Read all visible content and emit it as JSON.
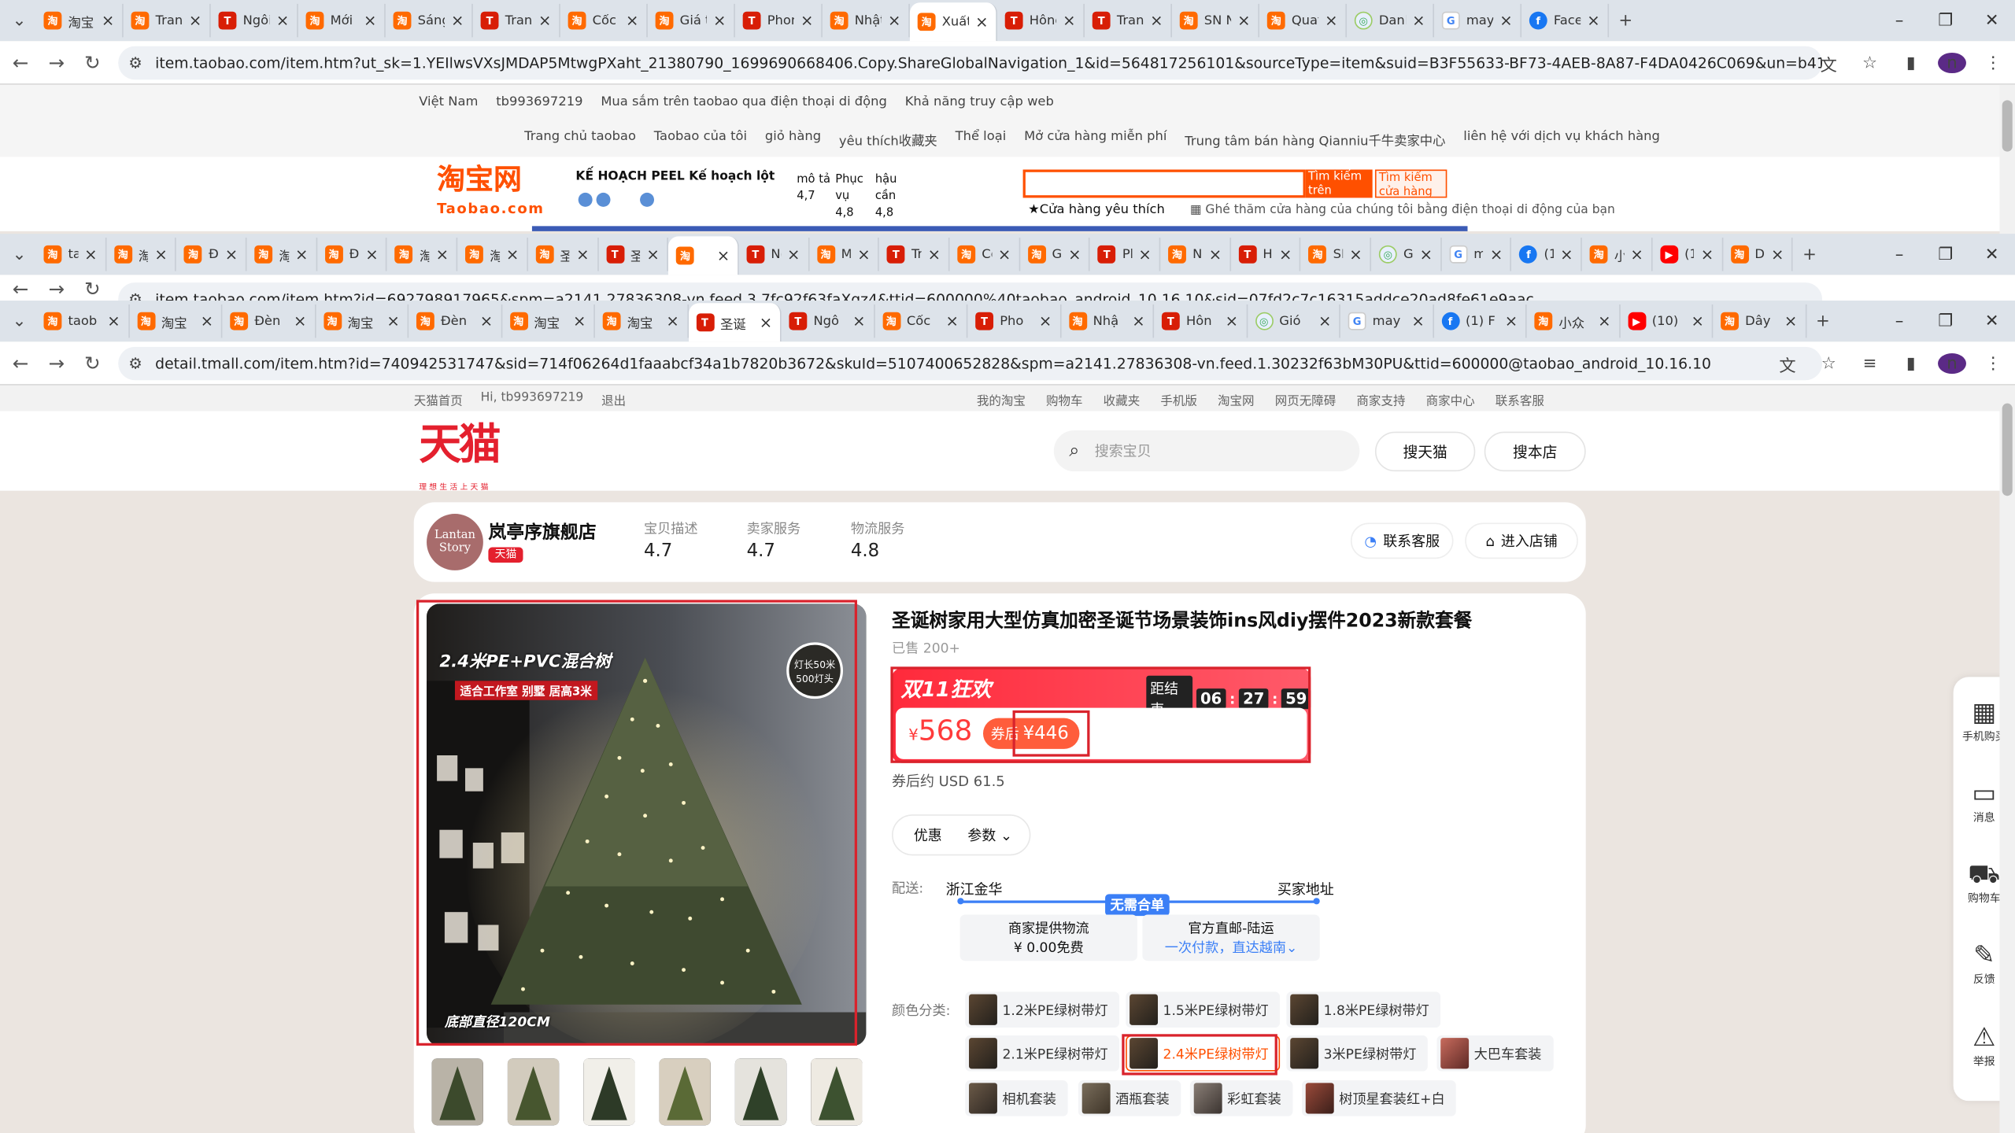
{
  "window1": {
    "tabs": [
      {
        "label": "淘宝",
        "icon": "taobao"
      },
      {
        "label": "Trang",
        "icon": "taobao"
      },
      {
        "label": "Ngôi",
        "icon": "tmall"
      },
      {
        "label": "Mới",
        "icon": "taobao"
      },
      {
        "label": "Sáng",
        "icon": "taobao"
      },
      {
        "label": "Tranh",
        "icon": "tmall"
      },
      {
        "label": "Cốc c",
        "icon": "taobao"
      },
      {
        "label": "Giá t",
        "icon": "taobao"
      },
      {
        "label": "Phon",
        "icon": "tmall"
      },
      {
        "label": "Nhật",
        "icon": "taobao"
      },
      {
        "label": "Xuất",
        "icon": "taobao",
        "active": true
      },
      {
        "label": "Hông",
        "icon": "tmall"
      },
      {
        "label": "Trang",
        "icon": "tmall"
      },
      {
        "label": "SN N",
        "icon": "taobao"
      },
      {
        "label": "Quat",
        "icon": "taobao"
      },
      {
        "label": "Danh",
        "icon": "globe"
      },
      {
        "label": "may",
        "icon": "g"
      },
      {
        "label": "Facel",
        "icon": "fb"
      }
    ],
    "url": "item.taobao.com/item.htm?ut_sk=1.YEIlwsVXsJMDAP5MtwgPXaht_21380790_1699690668406.Copy.ShareGlobalNavigation_1&id=564817256101&sourceType=item&suid=B3F55633-BF73-4AEB-8A87-F4DA0426C069&un=b41e035e55e69c9ff90c85b561b0b179&share_crt_v=..."
  },
  "taobao_page": {
    "top_row1": [
      "Việt Nam",
      "tb993697219",
      "Mua sắm trên taobao qua điện thoại di động",
      "Khả năng truy cập web"
    ],
    "top_row2": [
      "Trang chủ taobao",
      "Taobao của tôi",
      "giỏ hàng",
      "yêu thích收藏夹",
      "Thể loại",
      "Mở cửa hàng miễn phí",
      "Trung tâm bán hàng Qianniu千牛卖家中心",
      "liên hệ với dịch vụ khách hàng"
    ],
    "logo_main": "淘宝网",
    "logo_sub": "Taobao.com",
    "peel": "KẾ HOẠCH PEEL Kế hoạch lột",
    "ratings": {
      "c1": "mô tả",
      "c1v": "4,7",
      "c2": "Phục vụ",
      "c2v": "4,8",
      "c3": "hậu cần",
      "c3v": "4,8"
    },
    "search_btn1": "Tìm kiếm trên taobao",
    "search_btn2": "Tìm kiếm cửa hàng này",
    "fav_store": "Cửa hàng yêu thích",
    "visit_store": "Ghé thăm cửa hàng của chúng tôi bằng điện thoại di động của bạn"
  },
  "window2": {
    "tabs": [
      {
        "label": "taob",
        "icon": "taobao"
      },
      {
        "label": "淘宝",
        "icon": "taobao"
      },
      {
        "label": "Đèn",
        "icon": "taobao"
      },
      {
        "label": "淘宝",
        "icon": "taobao"
      },
      {
        "label": "Đèn",
        "icon": "taobao"
      },
      {
        "label": "淘宝",
        "icon": "taobao"
      },
      {
        "label": "淘宝",
        "icon": "taobao"
      },
      {
        "label": "圣诞",
        "icon": "taobao"
      },
      {
        "label": "圣诞",
        "icon": "tmall"
      },
      {
        "label": "",
        "icon": "taobao",
        "active": true
      },
      {
        "label": "Ngô",
        "icon": "tmall"
      },
      {
        "label": "Mới",
        "icon": "taobao"
      },
      {
        "label": "Tran",
        "icon": "tmall"
      },
      {
        "label": "Cốc",
        "icon": "taobao"
      },
      {
        "label": "Giá",
        "icon": "taobao"
      },
      {
        "label": "Phor",
        "icon": "tmall"
      },
      {
        "label": "Nhậ",
        "icon": "taobao"
      },
      {
        "label": "Hôn",
        "icon": "tmall"
      },
      {
        "label": "SN",
        "icon": "taobao"
      },
      {
        "label": "Gió",
        "icon": "globe"
      },
      {
        "label": "may",
        "icon": "g"
      },
      {
        "label": "(1) F",
        "icon": "fb"
      },
      {
        "label": "小众",
        "icon": "taobao"
      },
      {
        "label": "(10)",
        "icon": "yt"
      },
      {
        "label": "Dây",
        "icon": "taobao"
      }
    ],
    "url": "item.taobao.com/item.htm?id=692798917965&spm=a2141.27836308-vn.feed.3.7fc92f63faXqz4&ttid=600000%40taobao_android_10.16.10&sid=07fd2c7c16315addce20ad8fe61e9aac"
  },
  "window3": {
    "tabs": [
      {
        "label": "taob",
        "icon": "taobao"
      },
      {
        "label": "淘宝",
        "icon": "taobao"
      },
      {
        "label": "Đèn",
        "icon": "taobao"
      },
      {
        "label": "淘宝",
        "icon": "taobao"
      },
      {
        "label": "Đèn",
        "icon": "taobao"
      },
      {
        "label": "淘宝",
        "icon": "taobao"
      },
      {
        "label": "淘宝",
        "icon": "taobao"
      },
      {
        "label": "圣诞",
        "icon": "tmall",
        "active": true
      },
      {
        "label": "Ngô",
        "icon": "tmall"
      },
      {
        "label": "Cốc",
        "icon": "taobao"
      },
      {
        "label": "Pho",
        "icon": "tmall"
      },
      {
        "label": "Nhậ",
        "icon": "taobao"
      },
      {
        "label": "Hôn",
        "icon": "tmall"
      },
      {
        "label": "Gió",
        "icon": "globe"
      },
      {
        "label": "may",
        "icon": "g"
      },
      {
        "label": "(1) F",
        "icon": "fb"
      },
      {
        "label": "小众",
        "icon": "taobao"
      },
      {
        "label": "(10)",
        "icon": "yt"
      },
      {
        "label": "Dây",
        "icon": "taobao"
      }
    ],
    "url": "detail.tmall.com/item.htm?id=740942531747&sid=714f06264d1faaabcf34a1b7820b3672&skuId=5107400652828&spm=a2141.27836308-vn.feed.1.30232f63bM30PU&ttid=600000@taobao_android_10.16.10"
  },
  "tmall": {
    "top_left": [
      "天猫首页",
      "Hi, tb993697219",
      "退出"
    ],
    "top_right": [
      "我的淘宝",
      "购物车",
      "收藏夹",
      "手机版",
      "淘宝网",
      "网页无障碍",
      "商家支持",
      "商家中心",
      "联系客服"
    ],
    "logo": "天猫",
    "logo_sub": "理想生活上天猫",
    "search_placeholder": "搜索宝贝",
    "btn_search_tmall": "搜天猫",
    "btn_search_shop": "搜本店",
    "shop": {
      "logo_text": "Lantan Story",
      "name": "岚亭序旗舰店",
      "badge": "天猫",
      "scores": [
        {
          "label": "宝贝描述",
          "value": "4.7"
        },
        {
          "label": "卖家服务",
          "value": "4.7"
        },
        {
          "label": "物流服务",
          "value": "4.8"
        }
      ],
      "btn_service": "联系客服",
      "btn_enter": "进入店铺"
    },
    "product": {
      "img_text1": "2.4米PE+PVC混合树",
      "img_text2": "适合工作室 别墅 居高3米",
      "img_text3": "底部直径120CM",
      "img_badge": "灯长50米 500灯头",
      "title": "圣诞树家用大型仿真加密圣诞节场景装饰ins风diy摆件2023新款套餐",
      "sold": "已售 200+",
      "promo_title": "双11狂欢",
      "countdown_label": "距结束",
      "countdown": [
        "06",
        "27",
        "59"
      ],
      "price_symbol": "¥",
      "price": "568",
      "coupon_label": "券后",
      "coupon_price": "¥446",
      "usd": "券后约 USD 61.5",
      "tab_discount": "优惠",
      "tab_params": "参数",
      "ship_label": "配送:",
      "ship_from": "浙江金华",
      "ship_to": "买家地址",
      "ship_badge": "无需合单",
      "ship_box1_l1": "商家提供物流",
      "ship_box1_l2": "¥ 0.00免费",
      "ship_box2_l1": "官方直邮-陆运",
      "ship_box2_l2": "一次付款，直达越南",
      "color_label": "颜色分类:",
      "options": [
        "1.2米PE绿树带灯",
        "1.5米PE绿树带灯",
        "1.8米PE绿树带灯",
        "2.1米PE绿树带灯",
        "2.4米PE绿树带灯",
        "3米PE绿树带灯",
        "大巴车套装",
        "相机套装",
        "酒瓶套装",
        "彩虹套装",
        "树顶星套装红+白"
      ],
      "selected_option": "2.4米PE绿树带灯"
    },
    "side": [
      "手机购买",
      "消息",
      "购物车",
      "反馈",
      "举报"
    ]
  }
}
